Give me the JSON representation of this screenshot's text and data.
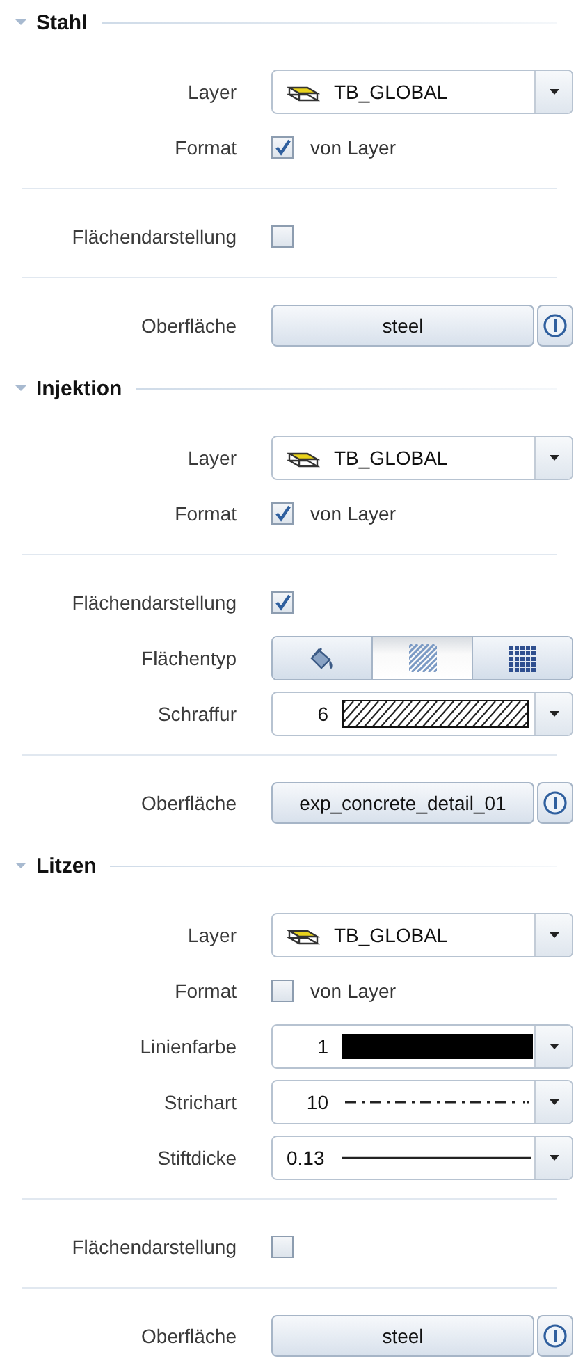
{
  "sections": [
    {
      "title": "Stahl",
      "expanded": true,
      "groups": [
        {
          "rows": [
            {
              "kind": "layer",
              "label": "Layer",
              "value": "TB_GLOBAL"
            },
            {
              "kind": "checkbox",
              "label": "Format",
              "text": "von Layer",
              "checked": true
            }
          ]
        },
        {
          "rows": [
            {
              "kind": "checkbox",
              "label": "Flächendarstellung",
              "checked": false
            }
          ]
        },
        {
          "rows": [
            {
              "kind": "button",
              "label": "Oberfläche",
              "value": "steel"
            }
          ]
        }
      ]
    },
    {
      "title": "Injektion",
      "expanded": true,
      "groups": [
        {
          "rows": [
            {
              "kind": "layer",
              "label": "Layer",
              "value": "TB_GLOBAL"
            },
            {
              "kind": "checkbox",
              "label": "Format",
              "text": "von Layer",
              "checked": true
            }
          ]
        },
        {
          "rows": [
            {
              "kind": "checkbox",
              "label": "Flächendarstellung",
              "checked": true
            },
            {
              "kind": "segmented",
              "label": "Flächentyp",
              "options": [
                {
                  "kind": "fill",
                  "selected": false
                },
                {
                  "kind": "hatch",
                  "selected": true
                },
                {
                  "kind": "pattern",
                  "selected": false
                }
              ]
            },
            {
              "kind": "hatch",
              "label": "Schraffur",
              "value": "6"
            }
          ]
        },
        {
          "rows": [
            {
              "kind": "button",
              "label": "Oberfläche",
              "value": "exp_concrete_detail_01"
            }
          ]
        }
      ]
    },
    {
      "title": "Litzen",
      "expanded": true,
      "groups": [
        {
          "rows": [
            {
              "kind": "layer",
              "label": "Layer",
              "value": "TB_GLOBAL"
            },
            {
              "kind": "checkbox",
              "label": "Format",
              "text": "von Layer",
              "checked": false
            },
            {
              "kind": "color",
              "label": "Linienfarbe",
              "value": "1",
              "color": "#000000"
            },
            {
              "kind": "linetype",
              "label": "Strichart",
              "value": "10"
            },
            {
              "kind": "pen",
              "label": "Stiftdicke",
              "value": "0.13"
            }
          ]
        },
        {
          "rows": [
            {
              "kind": "checkbox",
              "label": "Flächendarstellung",
              "checked": false
            }
          ]
        },
        {
          "rows": [
            {
              "kind": "button",
              "label": "Oberfläche",
              "value": "steel"
            }
          ]
        }
      ]
    }
  ]
}
